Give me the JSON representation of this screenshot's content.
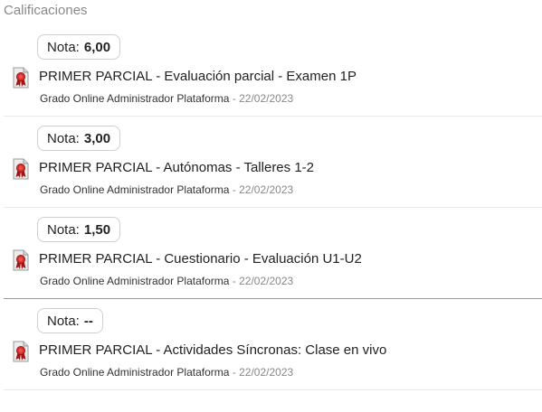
{
  "header": {
    "title": "Calificaciones"
  },
  "items": [
    {
      "grade_label": "Nota:",
      "grade_value": "6,00",
      "title": "PRIMER PARCIAL - Evaluación parcial - Examen 1P",
      "author": "Grado Online Administrador Plataforma",
      "separator": " - ",
      "date": "22/02/2023",
      "icon": "certificate-icon"
    },
    {
      "grade_label": "Nota:",
      "grade_value": "3,00",
      "title": "PRIMER PARCIAL - Autónomas - Talleres 1-2",
      "author": "Grado Online Administrador Plataforma",
      "separator": " - ",
      "date": "22/02/2023",
      "icon": "certificate-icon"
    },
    {
      "grade_label": "Nota:",
      "grade_value": "1,50",
      "title": "PRIMER PARCIAL - Cuestionario - Evaluación U1-U2",
      "author": "Grado Online Administrador Plataforma",
      "separator": " - ",
      "date": "22/02/2023",
      "icon": "certificate-icon"
    },
    {
      "grade_label": "Nota:",
      "grade_value": "--",
      "title": "PRIMER PARCIAL - Actividades Síncronas: Clase en vivo",
      "author": "Grado Online Administrador Plataforma",
      "separator": " - ",
      "date": "22/02/2023",
      "icon": "certificate-icon"
    }
  ],
  "colors": {
    "badge_border": "#cfcfcf",
    "seal_red": "#c62828",
    "muted_text": "#888888"
  }
}
